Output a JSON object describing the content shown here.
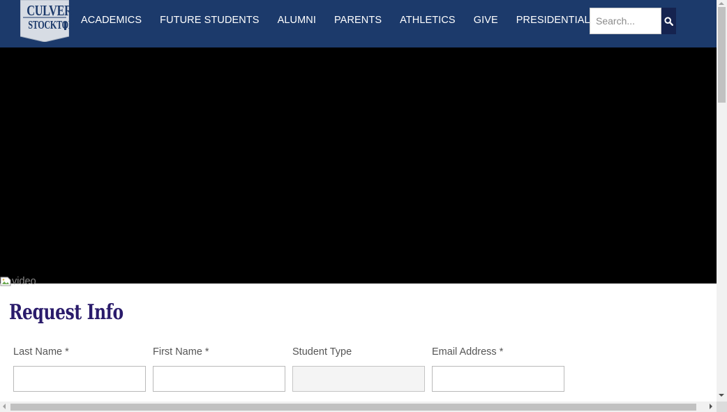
{
  "header": {
    "logo": {
      "line1": "CULVER",
      "line2": "STOCKTON"
    },
    "nav": [
      {
        "label": "ACADEMICS"
      },
      {
        "label": "FUTURE STUDENTS"
      },
      {
        "label": "ALUMNI"
      },
      {
        "label": "PARENTS"
      },
      {
        "label": "ATHLETICS"
      },
      {
        "label": "GIVE"
      },
      {
        "label": "PRESIDENTIAL SEARCH"
      }
    ],
    "search": {
      "placeholder": "Search...",
      "icon": "search-icon"
    }
  },
  "hero": {
    "image_alt": "video"
  },
  "form": {
    "title": "Request Info",
    "fields": [
      {
        "label": "Last Name *",
        "value": ""
      },
      {
        "label": "First Name *",
        "value": ""
      },
      {
        "label": "Student Type",
        "value": ""
      },
      {
        "label": "Email Address *",
        "value": ""
      }
    ]
  },
  "colors": {
    "header_bg": "#1c3a6b",
    "search_button": "#15234f",
    "hero_bg": "#000000",
    "form_title": "#2a1b6b",
    "label_text": "#555555"
  }
}
